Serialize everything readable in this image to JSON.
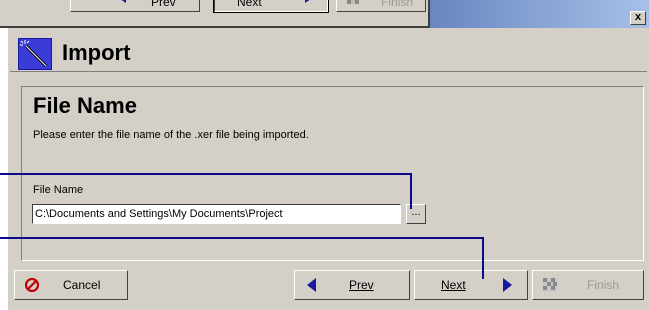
{
  "top_window": {
    "prev_label": "Prev",
    "next_label": "Next",
    "finish_label": "Finish"
  },
  "titlebar": {
    "close_glyph": "x"
  },
  "header": {
    "title": "Import",
    "icon": "wizard-wand-icon"
  },
  "section": {
    "title": "File Name",
    "description": "Please enter the file name of the .xer file being imported."
  },
  "file_field": {
    "label": "File Name",
    "value": "C:\\Documents and Settings\\My Documents\\Project",
    "browse_label": "..."
  },
  "buttons": {
    "cancel": "Cancel",
    "prev": "Prev",
    "next": "Next",
    "finish": "Finish"
  },
  "colors": {
    "dialog_bg": "#d4d0c8",
    "callout_line": "#0a0a8a",
    "arrow_blue": "#1a1aa0",
    "cancel_red": "#c00000",
    "titlebar_gradient_start": "#6a86c0",
    "titlebar_gradient_end": "#a6c0e8"
  }
}
